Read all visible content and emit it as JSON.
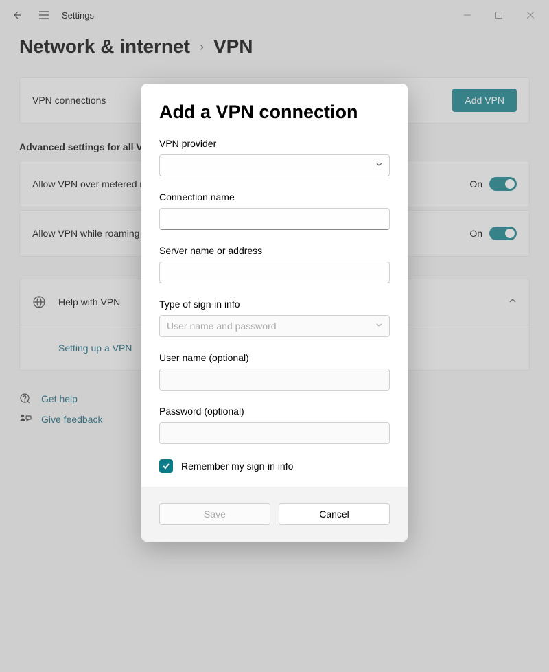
{
  "header": {
    "app": "Settings"
  },
  "breadcrumb": {
    "parent": "Network & internet",
    "current": "VPN"
  },
  "vpnConnections": {
    "label": "VPN connections",
    "addLabel": "Add VPN"
  },
  "advanced": {
    "sectionTitle": "Advanced settings for all VPN connections",
    "metered": {
      "label": "Allow VPN over metered networks",
      "state": "On"
    },
    "roaming": {
      "label": "Allow VPN while roaming",
      "state": "On"
    }
  },
  "help": {
    "label": "Help with VPN",
    "linkLabel": "Setting up a VPN"
  },
  "footer": {
    "getHelp": "Get help",
    "feedback": "Give feedback"
  },
  "modal": {
    "title": "Add a VPN connection",
    "provider": {
      "label": "VPN provider",
      "value": ""
    },
    "connectionName": {
      "label": "Connection name",
      "value": ""
    },
    "server": {
      "label": "Server name or address",
      "value": ""
    },
    "signinType": {
      "label": "Type of sign-in info",
      "value": "User name and password"
    },
    "username": {
      "label": "User name (optional)",
      "value": ""
    },
    "password": {
      "label": "Password (optional)",
      "value": ""
    },
    "remember": {
      "label": "Remember my sign-in info",
      "checked": true
    },
    "save": "Save",
    "cancel": "Cancel"
  }
}
